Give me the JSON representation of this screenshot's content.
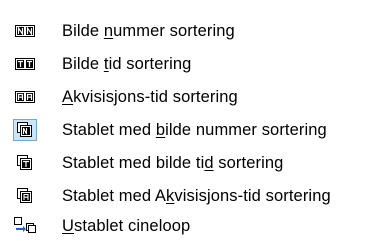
{
  "menu": {
    "items": [
      {
        "pre": "Bilde ",
        "key": "n",
        "post": "ummer sortering",
        "icon": "frame-number-sort-icon",
        "selected": false
      },
      {
        "pre": "Bilde ",
        "key": "t",
        "post": "id sortering",
        "icon": "frame-time-sort-icon",
        "selected": false
      },
      {
        "pre": "",
        "key": "A",
        "post": "kvisisjons-tid sortering",
        "icon": "acquisition-time-sort-icon",
        "selected": false
      },
      {
        "pre": "Stablet med ",
        "key": "b",
        "post": "ilde nummer sortering",
        "icon": "stacked-number-sort-icon",
        "selected": true
      },
      {
        "pre": "Stablet med bilde ti",
        "key": "d",
        "post": " sortering",
        "icon": "stacked-time-sort-icon",
        "selected": false
      },
      {
        "pre": "Stablet med A",
        "key": "k",
        "post": "visisjons-tid sortering",
        "icon": "stacked-acquisition-sort-icon",
        "selected": false
      },
      {
        "pre": "",
        "key": "U",
        "post": "stablet cineloop",
        "icon": "unstacked-cineloop-icon",
        "selected": false
      }
    ]
  },
  "colors": {
    "icon_stroke": "#000000",
    "selected_bg": "#cce4f7",
    "selected_border": "#6fa8dc",
    "arrow_blue": "#1f5fd1"
  }
}
